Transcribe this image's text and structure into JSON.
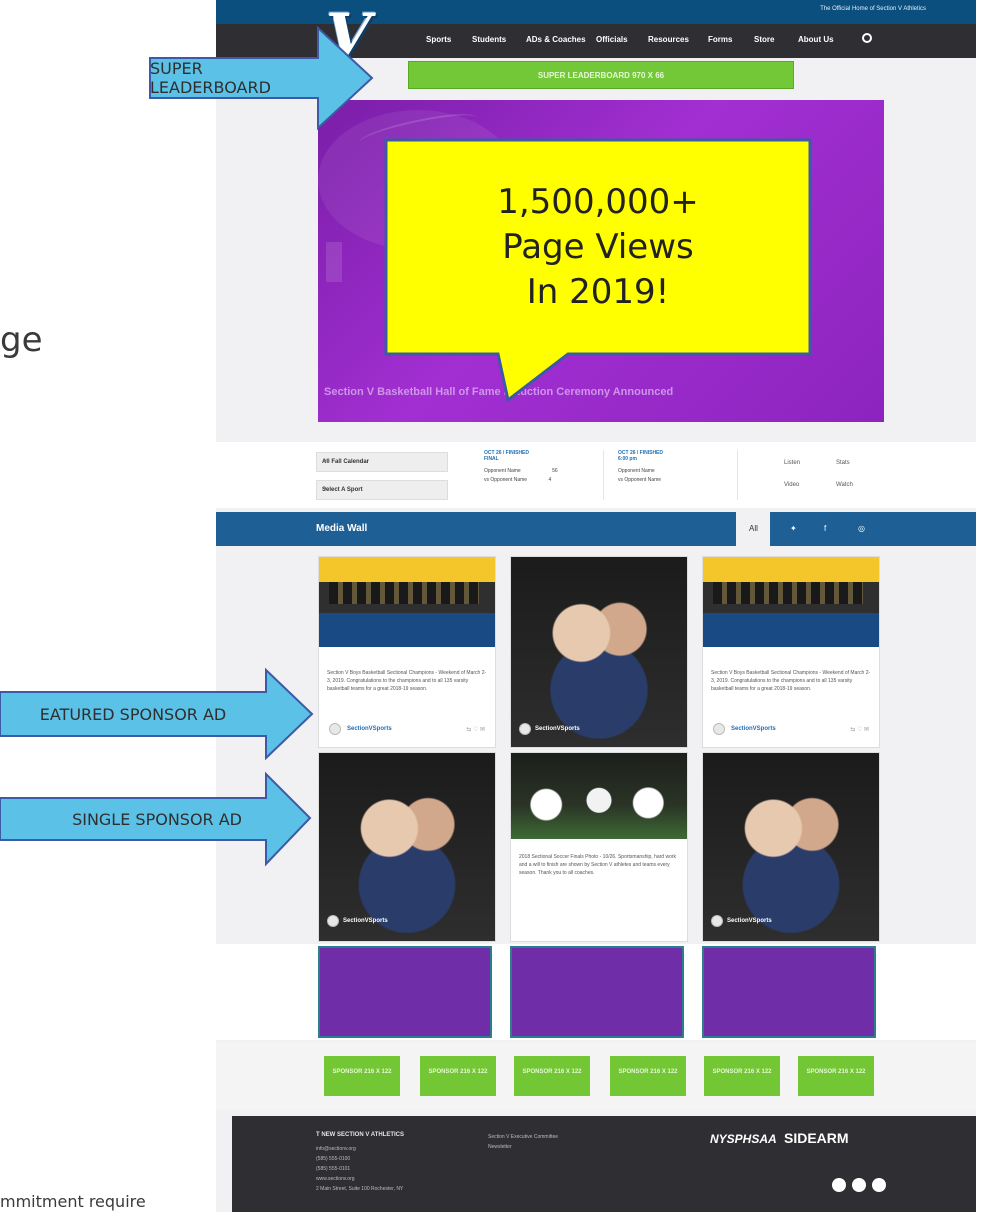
{
  "slide": {
    "cut_text_left": "ge",
    "cut_text_bottom": "mmitment require"
  },
  "site": {
    "top_strip_note": "The Official Home of Section V Athletics",
    "logo": "V",
    "nav_items": [
      "Sports",
      "Students",
      "ADs & Coaches",
      "Officials",
      "Resources",
      "Forms",
      "Store",
      "About Us"
    ],
    "leaderboard_label": "SUPER LEADERBOARD 970 X 66",
    "hero_headline": "Section V Basketball Hall of Fame Induction Ceremony Announced",
    "scoreboard": {
      "select_sport_filter": "All Fall Calendar",
      "select_sport": "Select A Sport",
      "games": [
        {
          "date": "OCT 26 / FINISHED",
          "status": "FINAL",
          "team1": "Opponent Name",
          "score1": "56",
          "team2": "vs Opponent Name",
          "score2": "4"
        },
        {
          "date": "OCT 26 / FINISHED",
          "status": "6:00 pm",
          "team1": "Opponent Name",
          "score1": "",
          "team2": "vs Opponent Name",
          "score2": ""
        }
      ],
      "links": [
        "Listen",
        "Stats",
        "Video",
        "Watch"
      ]
    },
    "media_wall": {
      "title": "Media Wall",
      "tabs": [
        "All",
        "Twitter",
        "Facebook",
        "Instagram"
      ],
      "cards": [
        {
          "caption": "Section V Boys Basketball Sectional Champions - Weekend of March 2-3, 2019. Congratulations to the champions and to all 135 varsity basketball teams for a great 2018-19 season.",
          "handle": "SectionVSports"
        },
        {
          "caption": "",
          "handle": "SectionVSports"
        },
        {
          "caption": "Section V Boys Basketball Sectional Champions - Weekend of March 2-3, 2019. Congratulations to the champions and to all 135 varsity basketball teams for a great 2018-19 season.",
          "handle": "SectionVSports"
        },
        {
          "caption": "",
          "handle": "SectionVSports"
        },
        {
          "caption": "2018 Sectional Soccer Finals Photo - 10/26. Sportsmanship, hard work and a will to finish are shown by Section V athletes and teams every season. Thank you to all coaches.",
          "handle": ""
        },
        {
          "caption": "",
          "handle": "SectionVSports"
        }
      ]
    },
    "sponsor_label": "SPONSOR 216 X 122",
    "footer": {
      "title": "T NEW SECTION V ATHLETICS",
      "lines": [
        "info@sectionv.org",
        "(585) 555-0100",
        "(585) 555-0101",
        "www.sectionv.org",
        "2 Main Street, Suite 100 Rochester, NY"
      ],
      "middle": [
        "Section V Executive Committee",
        "Newsletter"
      ],
      "logo1": "NYSPHSAA",
      "logo2": "SIDEARM"
    }
  },
  "callouts": {
    "super_leaderboard": "SUPER LEADERBOARD",
    "featured_sponsor": "EATURED SPONSOR AD",
    "single_sponsor": "SINGLE SPONSOR AD",
    "page_views_line1": "1,500,000+",
    "page_views_line2": "Page Views",
    "page_views_line3": "In 2019!"
  },
  "colors": {
    "arrow_fill": "#5bc1e6",
    "arrow_stroke": "#3c5aa6",
    "callout_fill": "#ffff00",
    "callout_stroke": "#3c5aa6",
    "featured_ad": "#6f2da8",
    "sponsor_ad": "#73c735"
  }
}
